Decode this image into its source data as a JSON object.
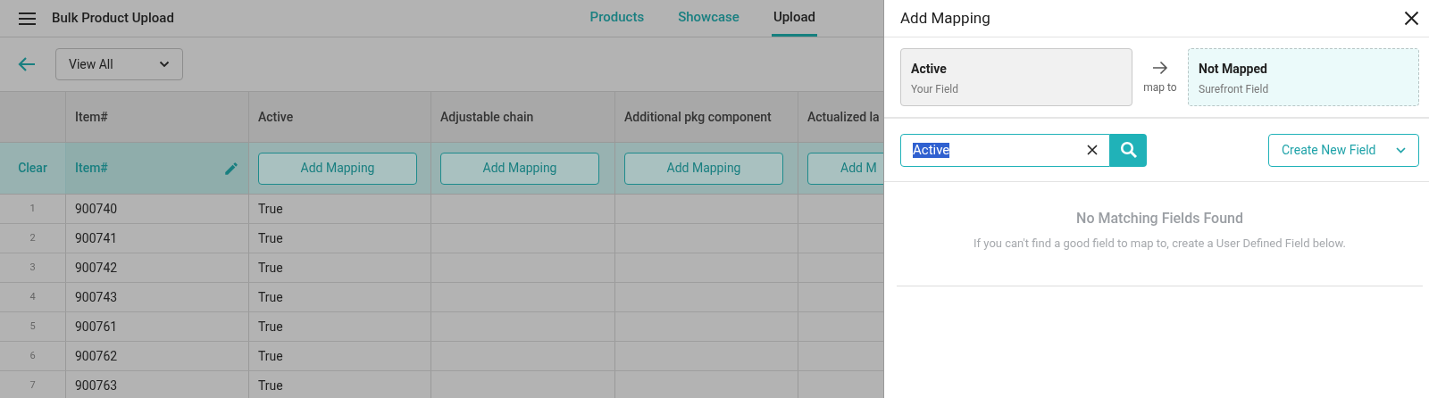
{
  "header": {
    "title": "Bulk Product Upload",
    "tabs": [
      {
        "label": "Products",
        "selected": false
      },
      {
        "label": "Showcase",
        "selected": false
      },
      {
        "label": "Upload",
        "selected": true
      }
    ]
  },
  "toolbar": {
    "filter": "View All"
  },
  "table": {
    "columns": [
      "Item#",
      "Active",
      "Adjustable chain",
      "Additional pkg component",
      "Actualized la"
    ],
    "mapping_row": {
      "clear": "Clear",
      "cells": [
        {
          "kind": "mapped",
          "label": "Item#"
        },
        {
          "kind": "button",
          "label": "Add Mapping"
        },
        {
          "kind": "button",
          "label": "Add Mapping"
        },
        {
          "kind": "button",
          "label": "Add Mapping"
        },
        {
          "kind": "cut_button",
          "label": "Add M"
        }
      ]
    },
    "rows": [
      {
        "number": "1",
        "cells": [
          "900740",
          "True"
        ]
      },
      {
        "number": "2",
        "cells": [
          "900741",
          "True"
        ]
      },
      {
        "number": "3",
        "cells": [
          "900742",
          "True"
        ]
      },
      {
        "number": "4",
        "cells": [
          "900743",
          "True"
        ]
      },
      {
        "number": "5",
        "cells": [
          "900761",
          "True"
        ]
      },
      {
        "number": "6",
        "cells": [
          "900762",
          "True"
        ]
      },
      {
        "number": "7",
        "cells": [
          "900763",
          "True"
        ]
      }
    ]
  },
  "panel": {
    "title": "Add Mapping",
    "source": {
      "name": "Active",
      "caption": "Your Field"
    },
    "connector": "map to",
    "target": {
      "name": "Not Mapped",
      "caption": "Surefront Field"
    },
    "search": {
      "value": "Active"
    },
    "create_button": "Create New Field",
    "empty": {
      "title": "No Matching Fields Found",
      "message": "If you can't find a good field to map to, create a User Defined Field below."
    }
  }
}
